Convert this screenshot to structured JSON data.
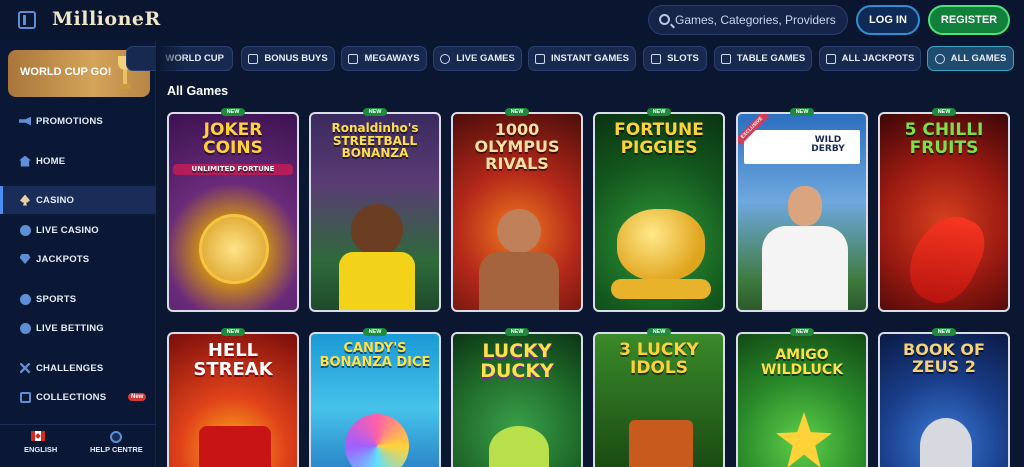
{
  "header": {
    "logo": "MillioneR",
    "search_placeholder": "Games, Categories, Providers",
    "login_label": "LOG IN",
    "register_label": "REGISTER"
  },
  "sidebar": {
    "banner_label": "WORLD CUP GO!",
    "items": [
      {
        "label": "PROMOTIONS",
        "icon": "megaphone-icon"
      },
      {
        "label": "HOME",
        "icon": "home-icon"
      },
      {
        "label": "CASINO",
        "icon": "spade-icon",
        "active": true
      },
      {
        "label": "LIVE CASINO",
        "icon": "globe-icon"
      },
      {
        "label": "JACKPOTS",
        "icon": "gem-icon"
      },
      {
        "label": "SPORTS",
        "icon": "ball-icon"
      },
      {
        "label": "LIVE BETTING",
        "icon": "live-icon"
      },
      {
        "label": "CHALLENGES",
        "icon": "swords-icon"
      },
      {
        "label": "COLLECTIONS",
        "icon": "layers-icon",
        "badge": "New"
      }
    ],
    "footer": {
      "language_label": "ENGLISH",
      "help_label": "HELP CENTRE"
    }
  },
  "categories": [
    "WORLD CUP",
    "BONUS BUYS",
    "MEGAWAYS",
    "LIVE GAMES",
    "INSTANT GAMES",
    "SLOTS",
    "TABLE GAMES",
    "ALL JACKPOTS",
    "ALL GAMES"
  ],
  "active_category": "ALL GAMES",
  "section_title": "All Games",
  "games_row1": [
    {
      "name": "JOKER COINS",
      "subtitle": "UNLIMITED FORTUNE",
      "tag": "NEW"
    },
    {
      "name": "Ronaldinho's STREETBALL BONANZA",
      "tag": "NEW"
    },
    {
      "name": "1000 OLYMPUS RIVALS",
      "tag": "NEW"
    },
    {
      "name": "FORTUNE PIGGIES",
      "tag": "NEW"
    },
    {
      "name": "WILD DERBY",
      "tag": "NEW",
      "exclusive": "EXCLUSIVE"
    },
    {
      "name": "5 CHILLI FRUITS",
      "tag": "NEW"
    }
  ],
  "games_row2": [
    {
      "name": "HELL STREAK",
      "tag": "NEW"
    },
    {
      "name": "CANDY'S BONANZA DICE",
      "tag": "NEW"
    },
    {
      "name": "LUCKY DUCKY",
      "tag": "NEW"
    },
    {
      "name": "3 LUCKY IDOLS",
      "tag": "NEW"
    },
    {
      "name": "AMIGO WILDLUCK",
      "tag": "NEW"
    },
    {
      "name": "BOOK OF ZEUS 2",
      "tag": "NEW"
    }
  ],
  "colors": {
    "background": "#0b1730",
    "accent": "#4b8ff0",
    "register": "#11803a",
    "new_tag": "#1d8a3c"
  }
}
